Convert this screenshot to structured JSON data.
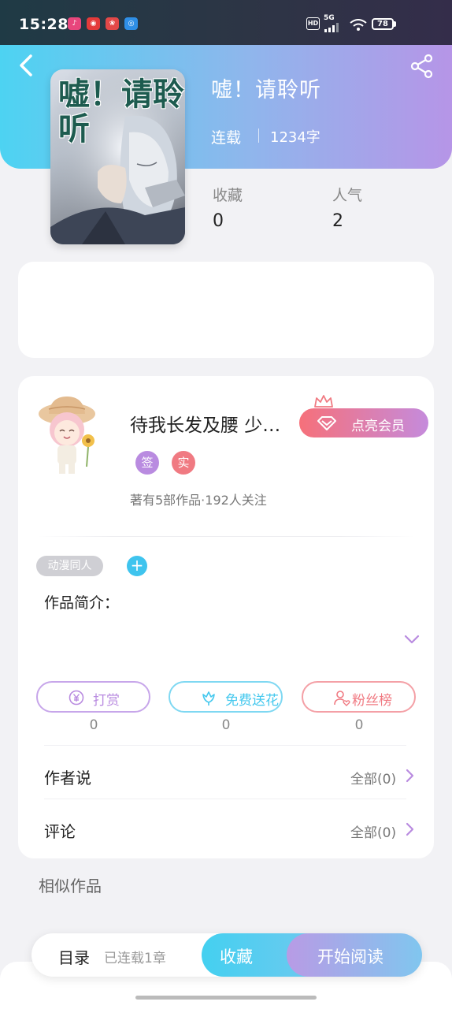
{
  "status_bar": {
    "time": "15:28",
    "hd": "HD",
    "network": "5G",
    "battery": "78"
  },
  "book": {
    "title": "嘘！请聆听",
    "cover_title": "嘘！请聆听",
    "serial_status": "连载",
    "word_count": "1234字",
    "stats": [
      {
        "label": "收藏",
        "value": "0"
      },
      {
        "label": "人气",
        "value": "2"
      }
    ]
  },
  "author": {
    "name": "待我长发及腰 少…",
    "vip_button": "点亮会员",
    "badges": [
      {
        "text": "签",
        "color": "#b98be0"
      },
      {
        "text": "实",
        "color": "#f07a82"
      }
    ],
    "stats": "著有5部作品·192人关注"
  },
  "tags": [
    "动漫同人"
  ],
  "add_tag": "+",
  "intro_label": "作品简介：",
  "actions": [
    {
      "label": "打赏",
      "count": "0",
      "color": "#b98be0"
    },
    {
      "label": "免费送花",
      "count": "0",
      "color": "#44c8ee"
    },
    {
      "label": "粉丝榜",
      "count": "0",
      "color": "#f07a82"
    }
  ],
  "rows": [
    {
      "title": "作者说",
      "all": "全部(0)"
    },
    {
      "title": "评论",
      "all": "全部(0)"
    }
  ],
  "similar_title": "相似作品",
  "bottom_bar": {
    "toc": "目录",
    "chapter_status": "已连载1章",
    "collect": "收藏",
    "read": "开始阅读"
  },
  "colors": {
    "header_start": "#4dd3f2",
    "header_end": "#b695e7",
    "accent_blue": "#44c8ee",
    "accent_purple": "#b98be0",
    "accent_pink": "#f07a82"
  },
  "icons": [
    "back-arrow-icon",
    "share-icon",
    "crown-icon",
    "diamond-icon",
    "yen-coin-icon",
    "flower-icon",
    "user-heart-icon",
    "chevron-down-icon",
    "chevron-right-icon"
  ]
}
